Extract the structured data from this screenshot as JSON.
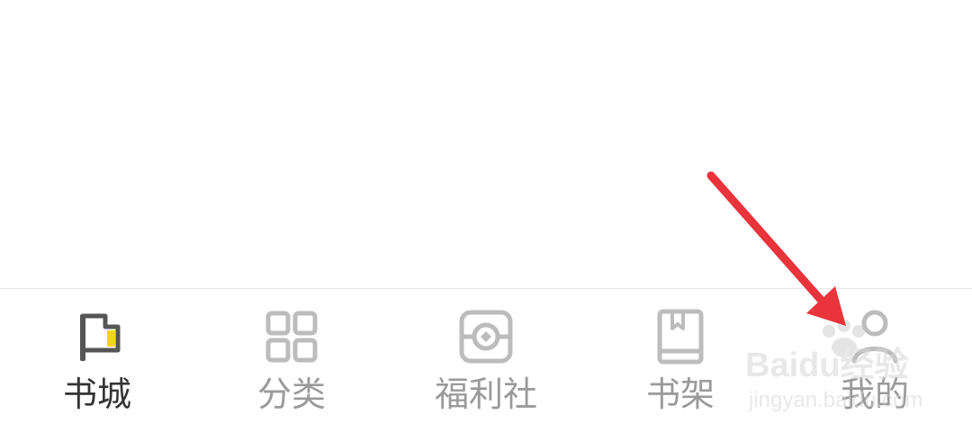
{
  "tabbar": {
    "tabs": [
      {
        "label": "书城",
        "icon": "bookstore-flag-icon",
        "active": true
      },
      {
        "label": "分类",
        "icon": "grid-icon",
        "active": false
      },
      {
        "label": "福利社",
        "icon": "welfare-coin-icon",
        "active": false
      },
      {
        "label": "书架",
        "icon": "bookshelf-book-icon",
        "active": false
      },
      {
        "label": "我的",
        "icon": "person-icon",
        "active": false
      }
    ]
  },
  "colors": {
    "active_text": "#333333",
    "inactive_text": "#9a9a9a",
    "inactive_icon": "#bcbcbc",
    "active_icon_stroke": "#555555",
    "accent_yellow": "#f7d21a",
    "annotation_arrow": "#e8343a"
  },
  "watermark": {
    "brand": "Baidu经验",
    "url": "jingyan.baidu.com"
  }
}
